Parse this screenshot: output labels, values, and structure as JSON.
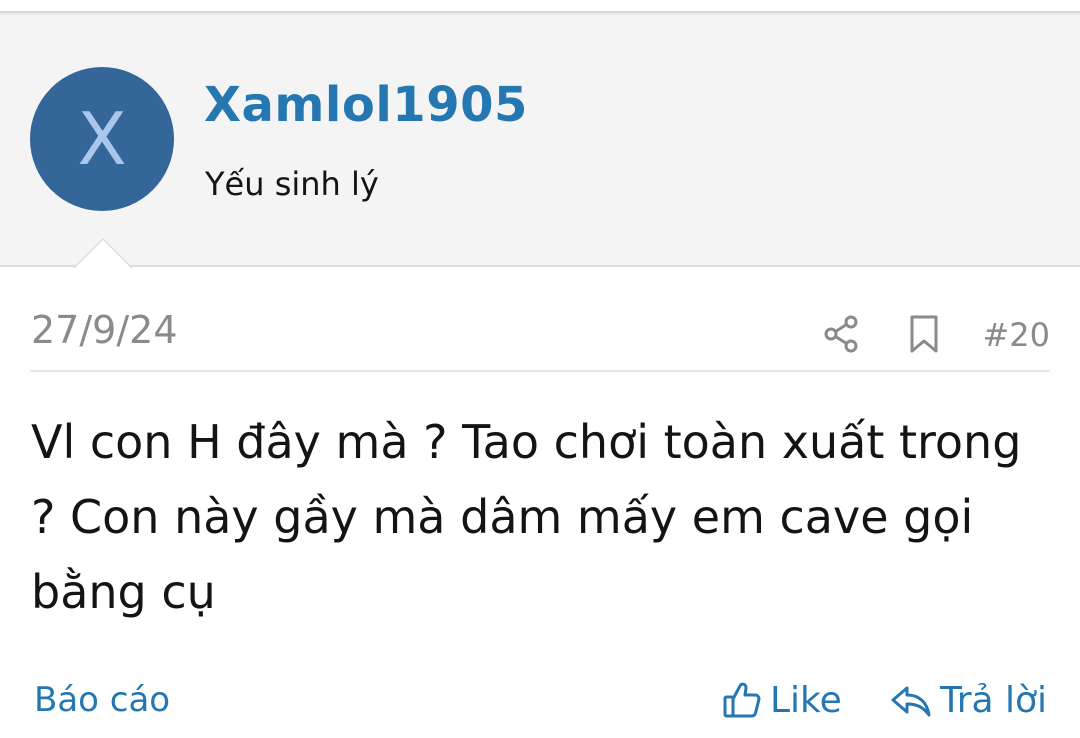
{
  "user": {
    "avatar_letter": "X",
    "name": "Xamlol1905",
    "title": "Yếu sinh lý"
  },
  "post": {
    "date": "27/9/24",
    "number": "#20",
    "body": "Vl con H đây mà ? Tao chơi toàn xuất trong ? Con này gầy mà dâm mấy em cave gọi bằng cụ"
  },
  "actions": {
    "report_label": "Báo cáo",
    "like_label": "Like",
    "reply_label": "Trả lời"
  },
  "colors": {
    "accent": "#2577b1",
    "avatar_bg": "#346699",
    "avatar_letter": "#a9c6ec",
    "muted": "#8a8a8a"
  },
  "icons": [
    "share-icon",
    "bookmark-icon",
    "thumbs-up-icon",
    "reply-icon"
  ]
}
